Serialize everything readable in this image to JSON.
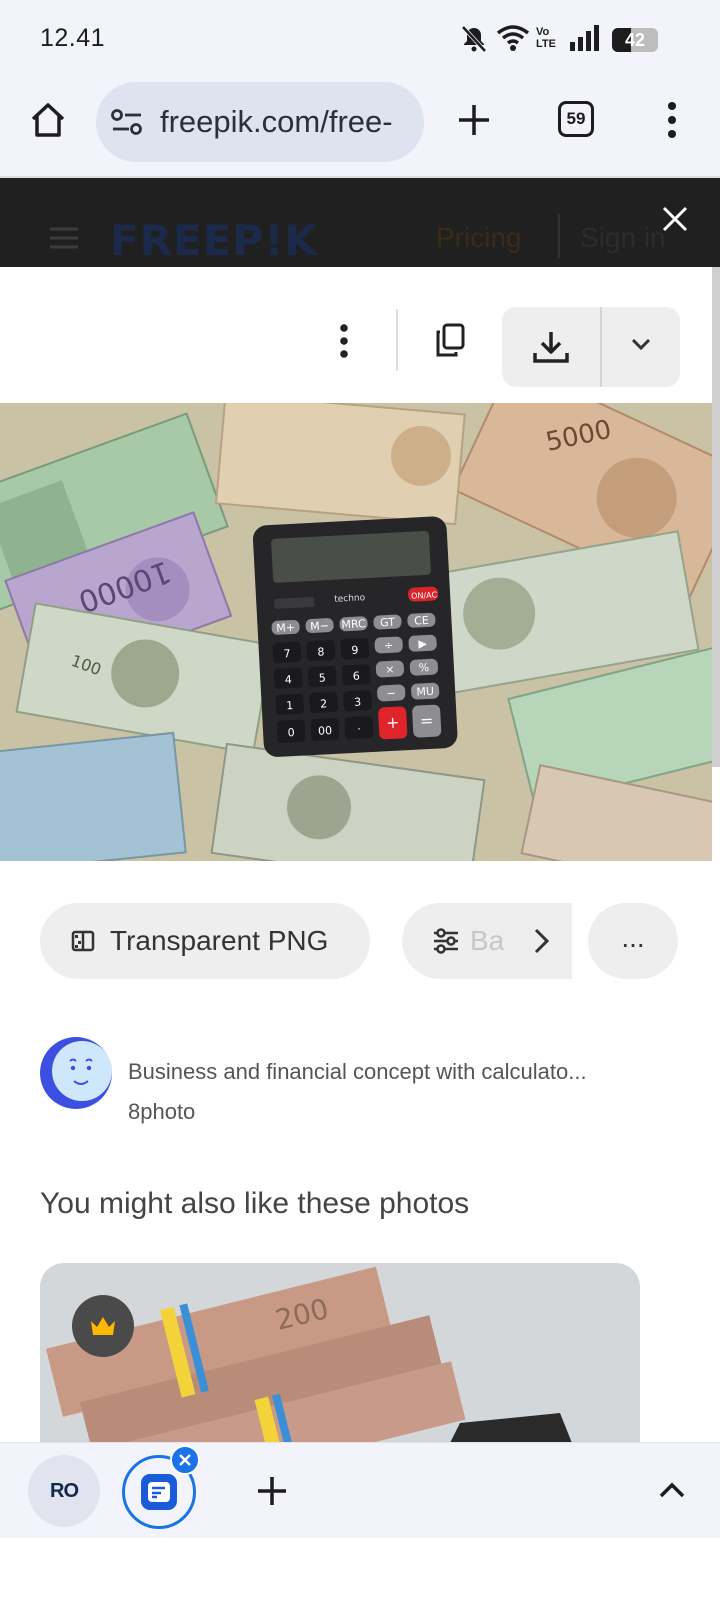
{
  "status_bar": {
    "time": "12.41",
    "battery": "42",
    "icons": [
      "mute-icon",
      "wifi-icon",
      "volte-icon",
      "signal-icon",
      "battery-icon"
    ],
    "volte_text": "Vo LTE"
  },
  "browser": {
    "url": "freepik.com/free-",
    "tab_count": "59",
    "icons": [
      "home-icon",
      "site-settings-icon",
      "new-tab-icon",
      "tab-switcher-icon",
      "more-menu-icon"
    ]
  },
  "site_header": {
    "logo": "FREEP!K",
    "pricing": "Pricing",
    "sign_in": "Sign in",
    "close_label": "✕"
  },
  "actions": {
    "icons": [
      "more-vertical-icon",
      "copy-icon",
      "download-icon",
      "chevron-down-icon"
    ]
  },
  "photo": {
    "alt_subject": "calculator on banknotes",
    "calculator_keys": [
      "M+",
      "M−",
      "MRC",
      "GT",
      "CE",
      "7",
      "8",
      "9",
      "÷",
      "▶",
      "4",
      "5",
      "6",
      "×",
      "%",
      "1",
      "2",
      "3",
      "−",
      "MU",
      "0",
      "00",
      "·",
      "+",
      "="
    ],
    "on_key": "ON/AC",
    "brand": "techno",
    "note_5000": "5000",
    "note_10000": "10000",
    "note_100": "100"
  },
  "chips": {
    "transparent_png": "Transparent PNG",
    "background": "Ba",
    "more": "..."
  },
  "author": {
    "title": "Business and financial concept with calculato...",
    "name": "8photo"
  },
  "related": {
    "heading": "You might also like these photos",
    "thumb_note": "200"
  },
  "colors": {
    "accent": "#1a73e8",
    "premium": "#ffb800",
    "header_bg": "#202020"
  },
  "tabstrip": {
    "tab1_label": "RO",
    "add": "+"
  }
}
